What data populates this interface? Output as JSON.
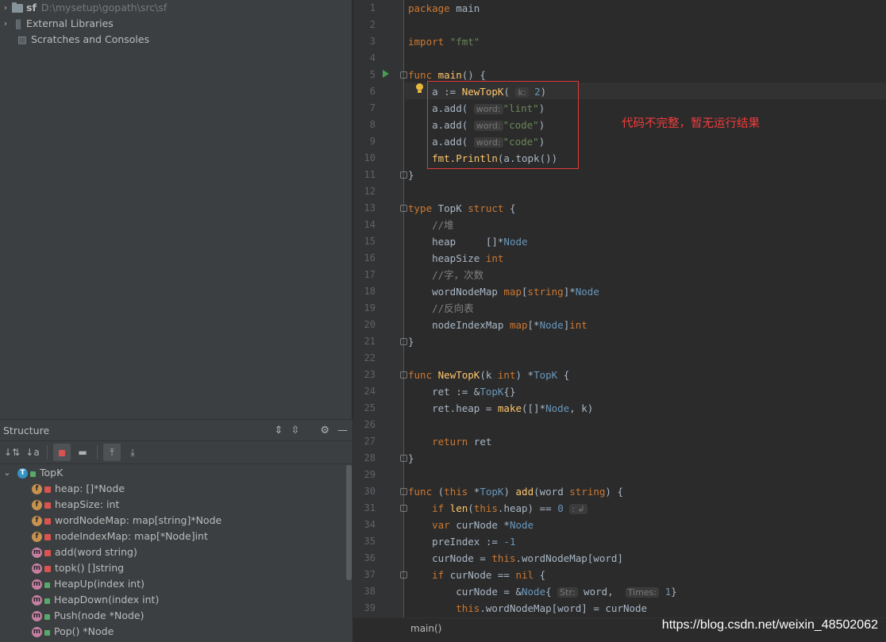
{
  "project_tree": {
    "root": {
      "name": "sf",
      "path": "D:\\mysetup\\gopath\\src\\sf"
    },
    "external_libraries": "External Libraries",
    "scratches": "Scratches and Consoles"
  },
  "structure": {
    "title": "Structure",
    "root": "TopK",
    "items": [
      {
        "kind": "f",
        "label": "heap: []*Node"
      },
      {
        "kind": "f",
        "label": "heapSize: int"
      },
      {
        "kind": "f",
        "label": "wordNodeMap: map[string]*Node"
      },
      {
        "kind": "f",
        "label": "nodeIndexMap: map[*Node]int"
      },
      {
        "kind": "m",
        "label": "add(word string)"
      },
      {
        "kind": "m",
        "label": "topk() []string"
      },
      {
        "kind": "m",
        "label": "HeapUp(index int)"
      },
      {
        "kind": "m",
        "label": "HeapDown(index int)"
      },
      {
        "kind": "m",
        "label": "Push(node *Node)"
      },
      {
        "kind": "m",
        "label": "Pop() *Node"
      }
    ]
  },
  "editor": {
    "line_numbers": [
      "1",
      "2",
      "3",
      "4",
      "5",
      "6",
      "7",
      "8",
      "9",
      "10",
      "11",
      "12",
      "13",
      "14",
      "15",
      "16",
      "17",
      "18",
      "19",
      "20",
      "21",
      "22",
      "23",
      "24",
      "25",
      "26",
      "27",
      "28",
      "29",
      "30",
      "31",
      "34",
      "35",
      "36",
      "37",
      "38",
      "39"
    ],
    "annotation": "代码不完整，暂无运行结果",
    "breadcrumb": "main()",
    "hints": {
      "k": "k:",
      "word": "word:",
      "str": "Str:",
      "times": "Times:"
    }
  },
  "watermark": "https://blog.csdn.net/weixin_48502062",
  "colors": {
    "keyword": "#cc7832",
    "string": "#6a8759",
    "number": "#6897bb",
    "function": "#ffc66d",
    "comment": "#808080",
    "annotation_red": "#f23c3c"
  }
}
